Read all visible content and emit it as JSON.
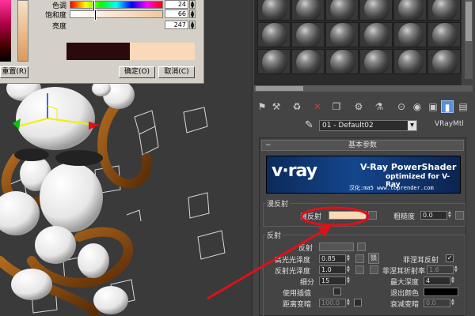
{
  "picker": {
    "hue_label": "色调",
    "hue_value": "24",
    "sat_label": "饱和度",
    "sat_value": "66",
    "val_label": "亮度",
    "val_value": "247",
    "reset_button": "重置(R)",
    "ok_button": "确定(O)",
    "cancel_button": "取消(C)",
    "new_color": "#fbd9b8",
    "old_color": "#2a0a0a"
  },
  "editor": {
    "material_name": "01 - Default02",
    "material_type": "VRayMtl",
    "rollout_title": "基本参数",
    "banner": {
      "logo": "v·ray",
      "title": "V-Ray PowerShader",
      "subtitle": "optimized for V-Ray",
      "credit": "汉化:ma5 www.toprender.com"
    },
    "diffuse": {
      "group_title": "漫反射",
      "diffuse_label": "漫反射",
      "roughness_label": "粗糙度",
      "roughness_value": "0.0",
      "color": "#fbd9b8"
    },
    "reflection": {
      "group_title": "反射",
      "reflect_label": "反射",
      "hilight_gloss_label": "高光光泽度",
      "hilight_gloss_value": "0.85",
      "lock_label": "锁",
      "fresnel_label": "菲涅耳反射",
      "refl_gloss_label": "反射光泽度",
      "refl_gloss_value": "1.0",
      "fresnel_ior_label": "菲涅耳折射率",
      "fresnel_ior_value": "1.6",
      "subdivs_label": "细分",
      "subdivs_value": "15",
      "max_depth_label": "最大深度",
      "max_depth_value": "4",
      "use_interp_label": "使用插值",
      "exit_color_label": "退出颜色",
      "dim_distance_label": "距离变暗",
      "dim_distance_value": "100.0",
      "dim_falloff_label": "衰减变暗",
      "dim_falloff_value": "0.0"
    }
  },
  "colors": {
    "accent_red": "#e0101a",
    "rope_brown": "#8a4a10"
  }
}
